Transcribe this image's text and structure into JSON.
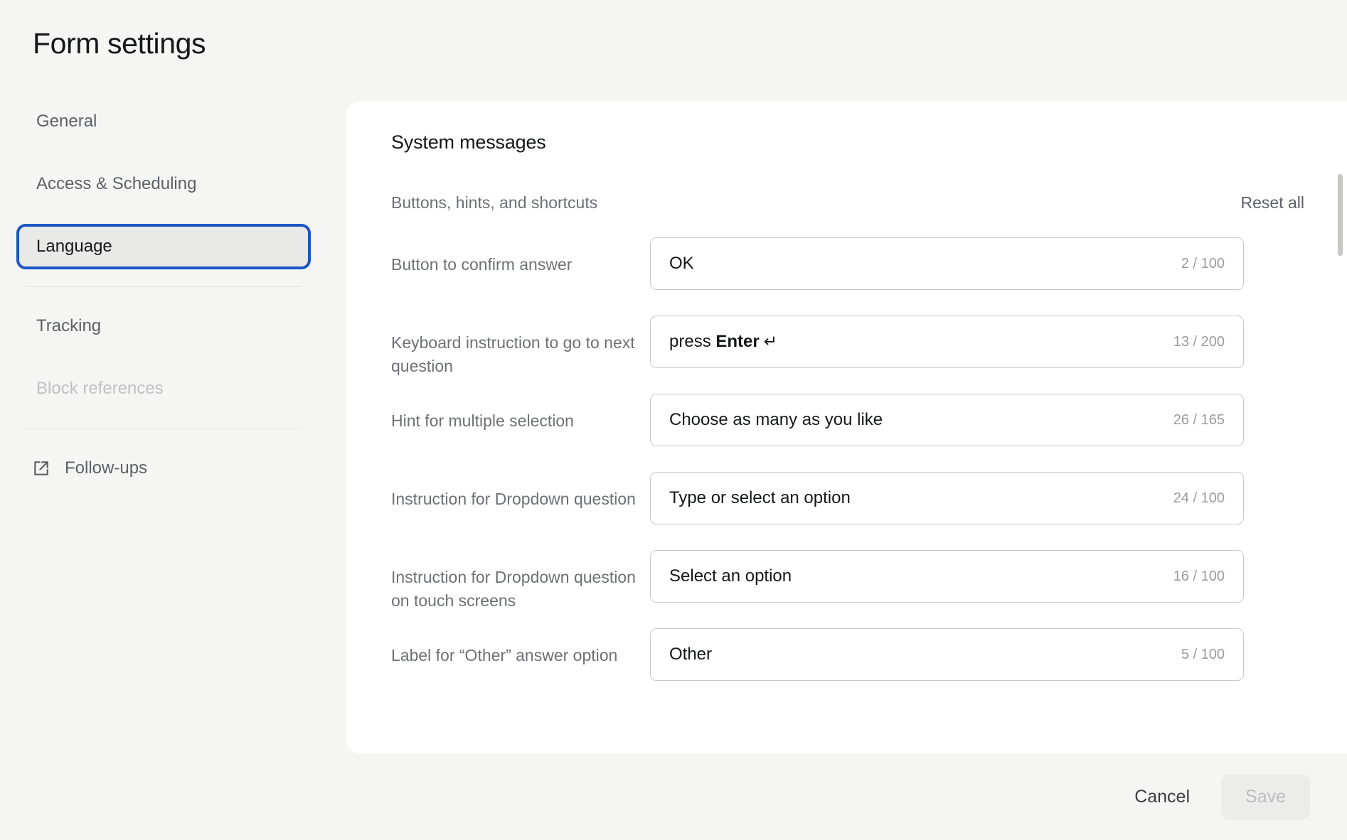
{
  "page": {
    "title": "Form settings",
    "background_color": "#f5f5f4",
    "accent_color": "#1a56c4"
  },
  "sidebar": {
    "items": [
      {
        "label": "General",
        "state": "normal",
        "icon": null
      },
      {
        "label": "Access & Scheduling",
        "state": "normal",
        "icon": null
      },
      {
        "label": "Language",
        "state": "active",
        "icon": null
      },
      {
        "label": "Tracking",
        "state": "normal",
        "icon": null
      },
      {
        "label": "Block references",
        "state": "muted",
        "icon": null
      },
      {
        "label": "Follow-ups",
        "state": "normal",
        "icon": "external-link-icon"
      }
    ]
  },
  "panel": {
    "title": "System messages",
    "section_label": "Buttons, hints, and shortcuts",
    "reset_all_label": "Reset all",
    "fields": [
      {
        "label": "Button to confirm answer",
        "value": "OK",
        "value_bold": "",
        "value_suffix": "",
        "count": "2 / 100",
        "length": 2,
        "max": 100
      },
      {
        "label": "Keyboard instruction to go to next question",
        "value": "press ",
        "value_bold": "Enter",
        "value_suffix": "↵",
        "count": "13 / 200",
        "length": 13,
        "max": 200
      },
      {
        "label": "Hint for multiple selection",
        "value": "Choose as many as you like",
        "value_bold": "",
        "value_suffix": "",
        "count": "26 / 165",
        "length": 26,
        "max": 165
      },
      {
        "label": "Instruction for Dropdown question",
        "value": "Type or select an option",
        "value_bold": "",
        "value_suffix": "",
        "count": "24 / 100",
        "length": 24,
        "max": 100
      },
      {
        "label": "Instruction for Dropdown question on touch screens",
        "value": "Select an option",
        "value_bold": "",
        "value_suffix": "",
        "count": "16 / 100",
        "length": 16,
        "max": 100
      },
      {
        "label": "Label for “Other” answer option",
        "value": "Other",
        "value_bold": "",
        "value_suffix": "",
        "count": "5 / 100",
        "length": 5,
        "max": 100
      }
    ]
  },
  "footer": {
    "cancel_label": "Cancel",
    "save_label": "Save",
    "save_enabled": false
  }
}
